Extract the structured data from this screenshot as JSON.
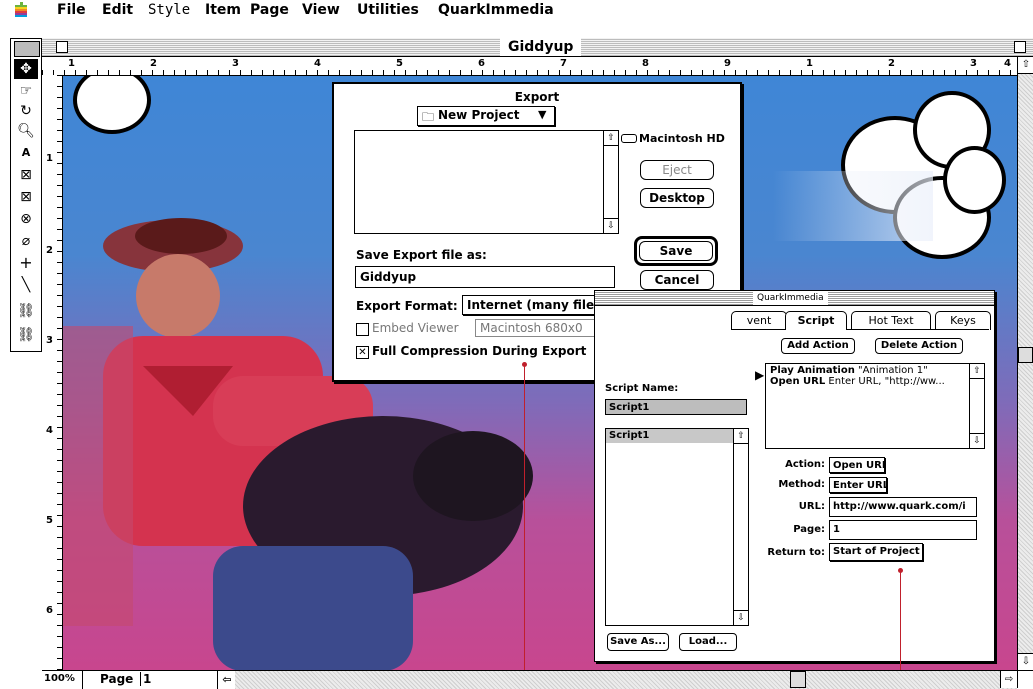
{
  "menubar": {
    "items": [
      "File",
      "Edit",
      "Style",
      "Item",
      "Page",
      "View",
      "Utilities",
      "QuarkImmedia"
    ]
  },
  "window": {
    "title": "Giddyup"
  },
  "rulers": {
    "horizontal": [
      "1",
      "2",
      "3",
      "4",
      "5",
      "6",
      "7",
      "8",
      "9",
      "1",
      "2",
      "3",
      "4"
    ],
    "vertical": [
      "1",
      "2",
      "3",
      "4",
      "5",
      "6"
    ]
  },
  "status": {
    "zoom": "100%",
    "page_label": "Page",
    "page_value": "1"
  },
  "export_dialog": {
    "title": "Export",
    "folder": "New Project",
    "volume": "Macintosh HD",
    "eject": "Eject",
    "desktop": "Desktop",
    "save_as_label": "Save Export file as:",
    "filename": "Giddyup",
    "save": "Save",
    "cancel": "Cancel",
    "format_label": "Export Format:",
    "format_value": "Internet (many files)",
    "embed_label": "Embed Viewer",
    "embed_value": "Macintosh 680x0",
    "compression_label": "Full Compression During Export"
  },
  "immedia_palette": {
    "title": "QuarkImmedia",
    "tabs": [
      "vent",
      "Script",
      "Hot Text",
      "Keys"
    ],
    "add_action": "Add Action",
    "delete_action": "Delete Action",
    "actions": [
      {
        "bold": "Play Animation",
        "rest": " \"Animation 1\""
      },
      {
        "bold": "Open URL",
        "rest": " Enter URL, \"http://ww..."
      }
    ],
    "script_name_label": "Script Name:",
    "script_name_value": "Script1",
    "scripts": [
      "Script1"
    ],
    "action_label": "Action:",
    "action_value": "Open URL",
    "method_label": "Method:",
    "method_value": "Enter URL",
    "url_label": "URL:",
    "url_value": "http://www.quark.com/i",
    "page_label": "Page:",
    "page_value": "1",
    "return_label": "Return to:",
    "return_value": "Start of Project",
    "save_as": "Save As...",
    "load": "Load..."
  },
  "colors": {
    "sky": "#3f86d6",
    "magenta": "#c8468e",
    "callout": "#c0202c"
  }
}
